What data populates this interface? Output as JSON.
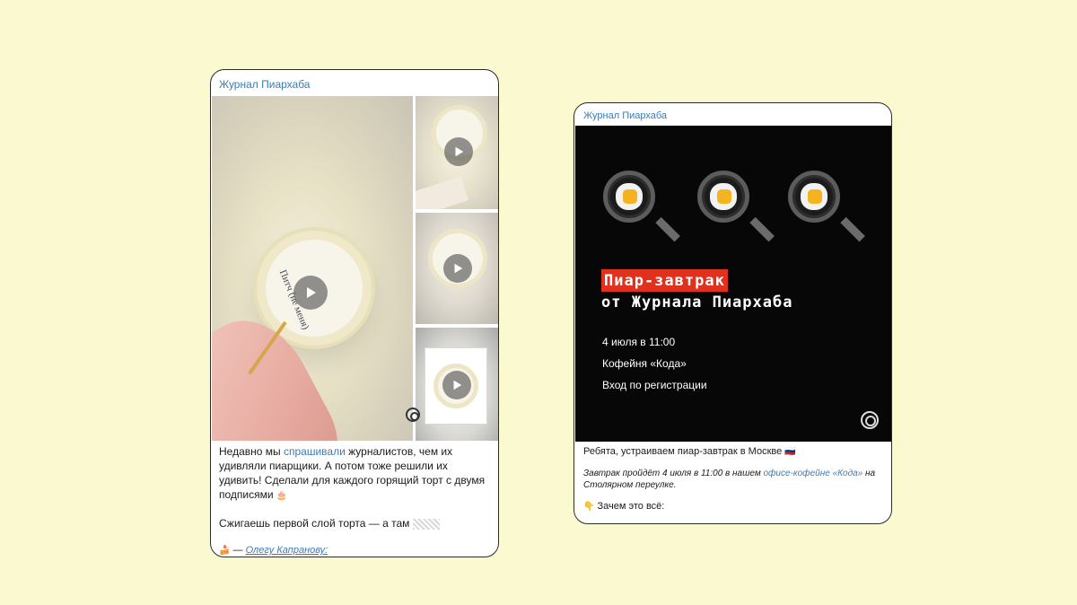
{
  "left_post": {
    "channel": "Журнал Пиархаба",
    "big_cake_text": "Питч (не меня)",
    "text_before_link": "Недавно мы ",
    "link_text": "спрашивали",
    "text_after_link": " журналистов, чем их удивляли пиарщики. А потом тоже решили их удивить! Сделали для каждого горящий торт с двумя подписями",
    "paragraph_2": "Сжигаешь первой слой торта — а там",
    "signature_dash": "— ",
    "signature_link": "Олегу Капранову:"
  },
  "right_post": {
    "channel": "Журнал Пиархаба",
    "headline_red": "Пиар-завтрак",
    "headline_white": "от Журнала Пиархаба",
    "detail_date": "4 июля в 11:00",
    "detail_place": "Кофейня «Кода»",
    "detail_entry": "Вход по регистрации",
    "lead": "Ребята, устраиваем пиар-завтрак в Москве",
    "italic_before_link": "Завтрак пройдёт 4 июля в 11:00 в нашем ",
    "italic_link": "офисе-кофейне «Кода»",
    "italic_after_link": " на Столярном переулке.",
    "why": "Зачем это всё:"
  },
  "colors": {
    "background": "#fbf9cf",
    "link": "#3a7cb8",
    "accent_red": "#e0301e",
    "banner_bg": "#070707"
  },
  "icons": [
    "play-icon",
    "watermark-logo-icon",
    "frying-pan-icon",
    "cake-emoji-icon",
    "pointing-hand-emoji-icon",
    "flag-emoji-icon"
  ]
}
